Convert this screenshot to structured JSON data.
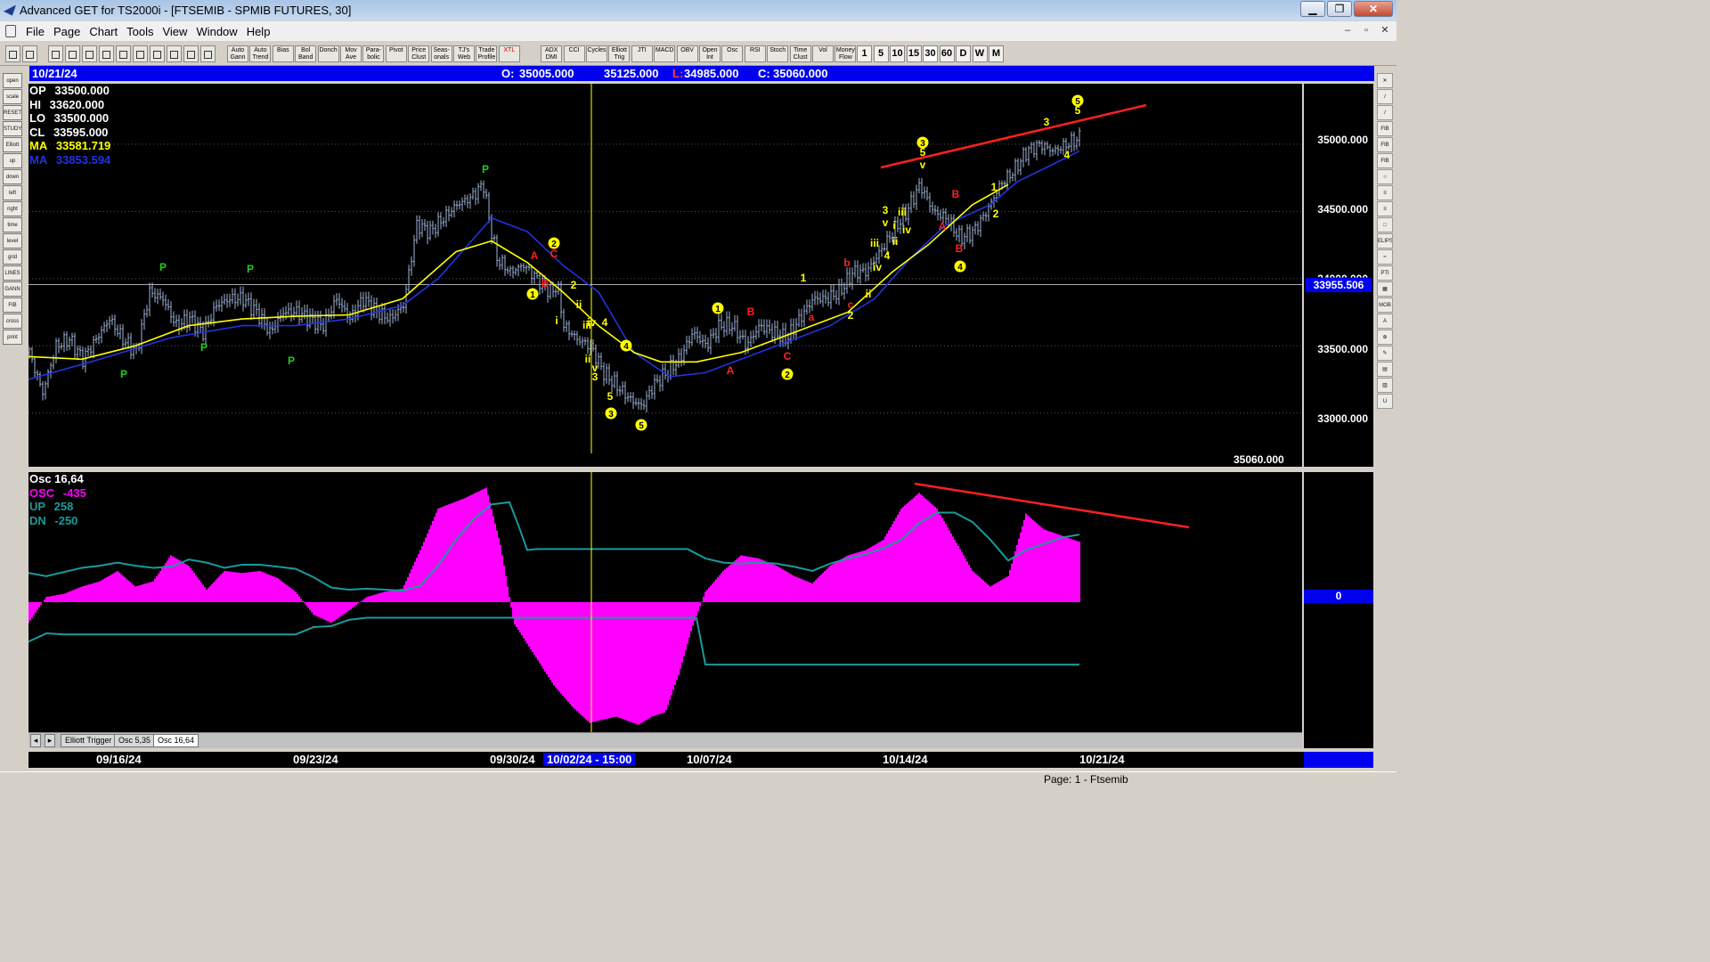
{
  "window": {
    "title": "Advanced GET for TS2000i - [FTSEMIB - SPMIB FUTURES, 30]",
    "min": "▁",
    "max": "❐",
    "close": "✕"
  },
  "menu": [
    "File",
    "Page",
    "Chart",
    "Tools",
    "View",
    "Window",
    "Help"
  ],
  "mdi": {
    "min": "–",
    "restore": "▫",
    "close": "✕"
  },
  "toolbar_studies": [
    "Auto Gann",
    "Auto Trend",
    "Bias",
    "Bol Band",
    "Donch",
    "Mov Ave",
    "Para-bolic",
    "Pivot",
    "Price Clust",
    "Seas-onals",
    "TJ's Web",
    "Trade Profile",
    "XTL",
    "ADX DMI",
    "CCI",
    "Cycles",
    "Elliott Trig",
    "JTI",
    "MACD",
    "OBV",
    "Open Int",
    "Osc",
    "RSI",
    "Stoch",
    "Time Clust",
    "Vol",
    "Money Flow"
  ],
  "periods": [
    "1",
    "5",
    "10",
    "15",
    "30",
    "60",
    "D",
    "W",
    "M"
  ],
  "left_tools": [
    "open",
    "scale",
    "RESET",
    "STUDY",
    "Elliott",
    "up",
    "down",
    "left",
    "right",
    "time",
    "level",
    "grid",
    "LINES",
    "GANN",
    "FIB",
    "cross",
    "print"
  ],
  "right_tools": [
    "✕",
    "/",
    "/",
    "FIB RET",
    "FIB EXT",
    "FIB TIME",
    "○",
    "≡",
    "≡",
    "□",
    "ELIPS",
    "≈",
    "PTI",
    "▦",
    "MOB",
    "A",
    "⊕",
    "✎",
    "▤",
    "▥",
    "U"
  ],
  "infobar": {
    "date": "10/21/24",
    "open_label": "O:",
    "open": "35005.000",
    "high": "35125.000",
    "low_label": "L:",
    "low": "34985.000",
    "close_label": "C:",
    "close": "35060.000"
  },
  "legend": [
    {
      "label": "OP",
      "value": "33500.000",
      "color": "#ffffff"
    },
    {
      "label": "HI",
      "value": "33620.000",
      "color": "#ffffff"
    },
    {
      "label": "LO",
      "value": "33500.000",
      "color": "#ffffff"
    },
    {
      "label": "CL",
      "value": "33595.000",
      "color": "#ffffff"
    },
    {
      "label": "MA",
      "value": "33581.719",
      "color": "#ffff00"
    },
    {
      "label": "MA",
      "value": "33853.594",
      "color": "#2233dd"
    }
  ],
  "osc_legend": [
    {
      "label": "Osc 16,64",
      "value": "",
      "color": "#ffffff"
    },
    {
      "label": "OSC",
      "value": "-435",
      "color": "#ff00ff"
    },
    {
      "label": "UP",
      "value": "258",
      "color": "#1a9a9a"
    },
    {
      "label": "DN",
      "value": "-250",
      "color": "#1a9a9a"
    }
  ],
  "yaxis": {
    "labels": [
      "35000.000",
      "34500.000",
      "34000.000",
      "33500.000",
      "33000.000"
    ],
    "current_price": "33955.506",
    "last_price": "35060.000",
    "osc_zero": "0"
  },
  "tabs": [
    "Elliott Trigger",
    "Osc 5,35",
    "Osc 16,64"
  ],
  "dates": {
    "labels": [
      "09/16/24",
      "09/23/24",
      "09/30/24",
      "10/07/24",
      "10/14/24",
      "10/21/24"
    ],
    "cursor": "10/02/24 - 15:00"
  },
  "status": "Page: 1 - Ftsemib",
  "colors": {
    "bars": "#9fb4d8",
    "ma_fast": "#ffff00",
    "ma_slow": "#2233dd",
    "osc": "#ff00ff",
    "bands": "#1a9a9a",
    "trend": "#ff2020",
    "wave_marker": "#ffff00",
    "wave_red": "#ff2020",
    "pivot": "#22cc22"
  },
  "chart_data": {
    "type": "candlestick",
    "ylim": [
      32600,
      35450
    ],
    "price_path": [
      [
        0,
        33450
      ],
      [
        15,
        33150
      ],
      [
        30,
        33500
      ],
      [
        45,
        33550
      ],
      [
        60,
        33400
      ],
      [
        75,
        33550
      ],
      [
        90,
        33700
      ],
      [
        105,
        33550
      ],
      [
        120,
        33450
      ],
      [
        135,
        33900
      ],
      [
        150,
        33850
      ],
      [
        165,
        33650
      ],
      [
        180,
        33700
      ],
      [
        195,
        33600
      ],
      [
        210,
        33800
      ],
      [
        225,
        33850
      ],
      [
        240,
        33850
      ],
      [
        255,
        33750
      ],
      [
        270,
        33600
      ],
      [
        285,
        33750
      ],
      [
        300,
        33750
      ],
      [
        315,
        33700
      ],
      [
        330,
        33650
      ],
      [
        345,
        33850
      ],
      [
        360,
        33700
      ],
      [
        375,
        33850
      ],
      [
        390,
        33750
      ],
      [
        405,
        33700
      ],
      [
        420,
        33800
      ],
      [
        435,
        34400
      ],
      [
        450,
        34350
      ],
      [
        465,
        34450
      ],
      [
        480,
        34550
      ],
      [
        495,
        34600
      ],
      [
        510,
        34700
      ],
      [
        516,
        34450
      ],
      [
        525,
        34150
      ],
      [
        540,
        34050
      ],
      [
        555,
        34100
      ],
      [
        570,
        34000
      ],
      [
        585,
        33900
      ],
      [
        593,
        33950
      ],
      [
        600,
        33650
      ],
      [
        615,
        33550
      ],
      [
        630,
        33500
      ],
      [
        645,
        33300
      ],
      [
        660,
        33200
      ],
      [
        675,
        33100
      ],
      [
        688,
        33050
      ],
      [
        700,
        33200
      ],
      [
        715,
        33300
      ],
      [
        730,
        33400
      ],
      [
        745,
        33600
      ],
      [
        760,
        33500
      ],
      [
        775,
        33650
      ],
      [
        790,
        33650
      ],
      [
        805,
        33500
      ],
      [
        820,
        33650
      ],
      [
        835,
        33600
      ],
      [
        850,
        33550
      ],
      [
        865,
        33700
      ],
      [
        880,
        33850
      ],
      [
        895,
        33850
      ],
      [
        910,
        33900
      ],
      [
        925,
        34050
      ],
      [
        940,
        34050
      ],
      [
        955,
        34200
      ],
      [
        970,
        34350
      ],
      [
        985,
        34500
      ],
      [
        1000,
        34700
      ],
      [
        1015,
        34500
      ],
      [
        1030,
        34450
      ],
      [
        1045,
        34300
      ],
      [
        1060,
        34350
      ],
      [
        1075,
        34500
      ],
      [
        1090,
        34700
      ],
      [
        1105,
        34800
      ],
      [
        1120,
        34950
      ],
      [
        1135,
        35000
      ],
      [
        1150,
        34950
      ],
      [
        1165,
        35000
      ],
      [
        1180,
        35050
      ]
    ],
    "ma_fast": [
      [
        0,
        33420
      ],
      [
        60,
        33400
      ],
      [
        120,
        33500
      ],
      [
        180,
        33650
      ],
      [
        240,
        33700
      ],
      [
        300,
        33720
      ],
      [
        360,
        33730
      ],
      [
        420,
        33850
      ],
      [
        480,
        34200
      ],
      [
        520,
        34280
      ],
      [
        560,
        34120
      ],
      [
        600,
        33900
      ],
      [
        640,
        33650
      ],
      [
        680,
        33450
      ],
      [
        710,
        33380
      ],
      [
        750,
        33380
      ],
      [
        800,
        33450
      ],
      [
        860,
        33600
      ],
      [
        920,
        33750
      ],
      [
        970,
        34050
      ],
      [
        1010,
        34250
      ],
      [
        1060,
        34550
      ],
      [
        1100,
        34700
      ]
    ],
    "ma_slow": [
      [
        0,
        33250
      ],
      [
        80,
        33400
      ],
      [
        160,
        33560
      ],
      [
        240,
        33650
      ],
      [
        300,
        33650
      ],
      [
        360,
        33700
      ],
      [
        420,
        33800
      ],
      [
        460,
        34000
      ],
      [
        500,
        34300
      ],
      [
        520,
        34450
      ],
      [
        560,
        34350
      ],
      [
        600,
        34100
      ],
      [
        640,
        33900
      ],
      [
        680,
        33450
      ],
      [
        720,
        33270
      ],
      [
        760,
        33300
      ],
      [
        840,
        33500
      ],
      [
        900,
        33650
      ],
      [
        950,
        33850
      ],
      [
        990,
        34150
      ],
      [
        1030,
        34400
      ],
      [
        1080,
        34550
      ],
      [
        1110,
        34720
      ],
      [
        1150,
        34850
      ],
      [
        1180,
        34950
      ]
    ],
    "osc": [
      [
        0,
        -200
      ],
      [
        20,
        50
      ],
      [
        40,
        80
      ],
      [
        60,
        150
      ],
      [
        80,
        200
      ],
      [
        100,
        300
      ],
      [
        120,
        150
      ],
      [
        140,
        200
      ],
      [
        160,
        450
      ],
      [
        180,
        350
      ],
      [
        200,
        120
      ],
      [
        220,
        300
      ],
      [
        240,
        280
      ],
      [
        260,
        300
      ],
      [
        280,
        230
      ],
      [
        300,
        100
      ],
      [
        320,
        -120
      ],
      [
        340,
        -200
      ],
      [
        360,
        -80
      ],
      [
        380,
        50
      ],
      [
        400,
        100
      ],
      [
        420,
        130
      ],
      [
        440,
        500
      ],
      [
        460,
        900
      ],
      [
        490,
        1000
      ],
      [
        514,
        1100
      ],
      [
        530,
        550
      ],
      [
        545,
        -200
      ],
      [
        560,
        -400
      ],
      [
        575,
        -600
      ],
      [
        590,
        -800
      ],
      [
        610,
        -1000
      ],
      [
        630,
        -1160
      ],
      [
        660,
        -1100
      ],
      [
        685,
        -1180
      ],
      [
        700,
        -1100
      ],
      [
        715,
        -1060
      ],
      [
        730,
        -700
      ],
      [
        745,
        -250
      ],
      [
        760,
        100
      ],
      [
        780,
        300
      ],
      [
        800,
        450
      ],
      [
        820,
        420
      ],
      [
        840,
        350
      ],
      [
        860,
        250
      ],
      [
        880,
        180
      ],
      [
        900,
        350
      ],
      [
        920,
        450
      ],
      [
        940,
        500
      ],
      [
        960,
        600
      ],
      [
        980,
        900
      ],
      [
        1000,
        1050
      ],
      [
        1020,
        900
      ],
      [
        1040,
        600
      ],
      [
        1060,
        300
      ],
      [
        1080,
        150
      ],
      [
        1100,
        250
      ],
      [
        1120,
        850
      ],
      [
        1140,
        700
      ],
      [
        1160,
        640
      ],
      [
        1180,
        580
      ]
    ],
    "osc_up": [
      [
        0,
        280
      ],
      [
        20,
        250
      ],
      [
        40,
        290
      ],
      [
        60,
        330
      ],
      [
        80,
        350
      ],
      [
        100,
        380
      ],
      [
        120,
        350
      ],
      [
        140,
        330
      ],
      [
        160,
        340
      ],
      [
        180,
        410
      ],
      [
        200,
        380
      ],
      [
        220,
        330
      ],
      [
        240,
        360
      ],
      [
        260,
        360
      ],
      [
        280,
        340
      ],
      [
        300,
        320
      ],
      [
        320,
        240
      ],
      [
        340,
        140
      ],
      [
        360,
        120
      ],
      [
        380,
        130
      ],
      [
        400,
        120
      ],
      [
        420,
        110
      ],
      [
        440,
        160
      ],
      [
        460,
        350
      ],
      [
        480,
        600
      ],
      [
        500,
        800
      ],
      [
        520,
        940
      ],
      [
        540,
        960
      ],
      [
        550,
        740
      ],
      [
        560,
        500
      ],
      [
        570,
        510
      ],
      [
        580,
        510
      ],
      [
        740,
        510
      ],
      [
        760,
        420
      ],
      [
        780,
        380
      ],
      [
        800,
        370
      ],
      [
        820,
        380
      ],
      [
        840,
        370
      ],
      [
        860,
        340
      ],
      [
        880,
        300
      ],
      [
        900,
        370
      ],
      [
        920,
        420
      ],
      [
        940,
        460
      ],
      [
        960,
        520
      ],
      [
        980,
        600
      ],
      [
        1000,
        760
      ],
      [
        1020,
        860
      ],
      [
        1040,
        860
      ],
      [
        1060,
        770
      ],
      [
        1080,
        600
      ],
      [
        1100,
        400
      ],
      [
        1120,
        500
      ],
      [
        1140,
        560
      ],
      [
        1160,
        620
      ],
      [
        1180,
        650
      ]
    ],
    "osc_dn": [
      [
        0,
        -380
      ],
      [
        20,
        -300
      ],
      [
        40,
        -310
      ],
      [
        300,
        -310
      ],
      [
        320,
        -240
      ],
      [
        340,
        -230
      ],
      [
        360,
        -170
      ],
      [
        380,
        -150
      ],
      [
        750,
        -150
      ],
      [
        760,
        -600
      ],
      [
        1180,
        -600
      ]
    ],
    "osc_ylim": [
      -1250,
      1250
    ]
  }
}
